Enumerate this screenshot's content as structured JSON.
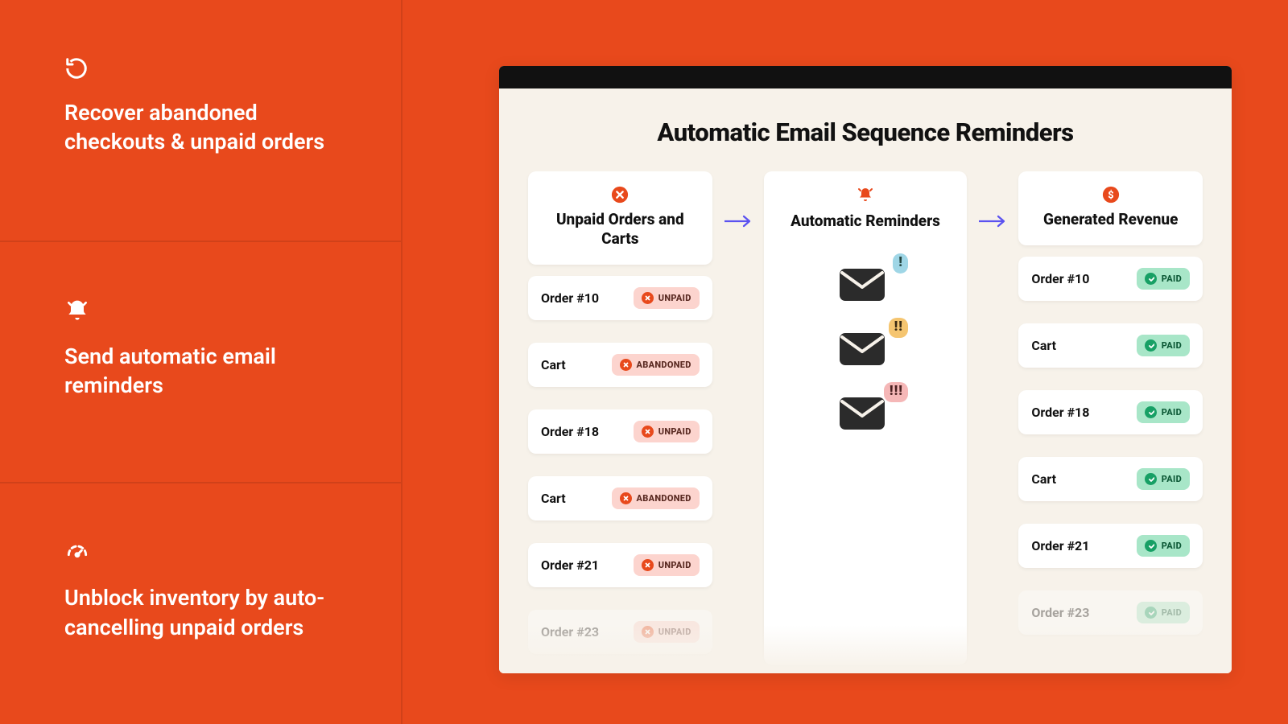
{
  "features": [
    {
      "icon": "undo-icon",
      "text": "Recover abandoned checkouts & unpaid orders"
    },
    {
      "icon": "bell-icon",
      "text": "Send automatic email reminders"
    },
    {
      "icon": "gauge-icon",
      "text": "Unblock inventory by auto-cancelling unpaid orders"
    }
  ],
  "window": {
    "title": "Automatic Email Sequence Reminders",
    "columns": {
      "left": {
        "icon": "x-circle-icon",
        "label": "Unpaid Orders and Carts"
      },
      "mid": {
        "icon": "bell-ring-icon",
        "label": "Automatic Reminders"
      },
      "right": {
        "icon": "dollar-circle-icon",
        "label": "Generated Revenue"
      }
    },
    "left_items": [
      {
        "name": "Order #10",
        "status": "UNPAID",
        "faded": false
      },
      {
        "name": "Cart",
        "status": "ABANDONED",
        "faded": false
      },
      {
        "name": "Order #18",
        "status": "UNPAID",
        "faded": false
      },
      {
        "name": "Cart",
        "status": "ABANDONED",
        "faded": false
      },
      {
        "name": "Order #21",
        "status": "UNPAID",
        "faded": false
      },
      {
        "name": "Order #23",
        "status": "UNPAID",
        "faded": true
      }
    ],
    "right_items": [
      {
        "name": "Order #10",
        "status": "PAID",
        "faded": false
      },
      {
        "name": "Cart",
        "status": "PAID",
        "faded": false
      },
      {
        "name": "Order #18",
        "status": "PAID",
        "faded": false
      },
      {
        "name": "Cart",
        "status": "PAID",
        "faded": false
      },
      {
        "name": "Order #21",
        "status": "PAID",
        "faded": false
      },
      {
        "name": "Order #23",
        "status": "PAID",
        "faded": true
      }
    ],
    "reminders": [
      {
        "count": 1,
        "bubble_class": "bub1"
      },
      {
        "count": 2,
        "bubble_class": "bub2"
      },
      {
        "count": 3,
        "bubble_class": "bub3"
      }
    ]
  }
}
